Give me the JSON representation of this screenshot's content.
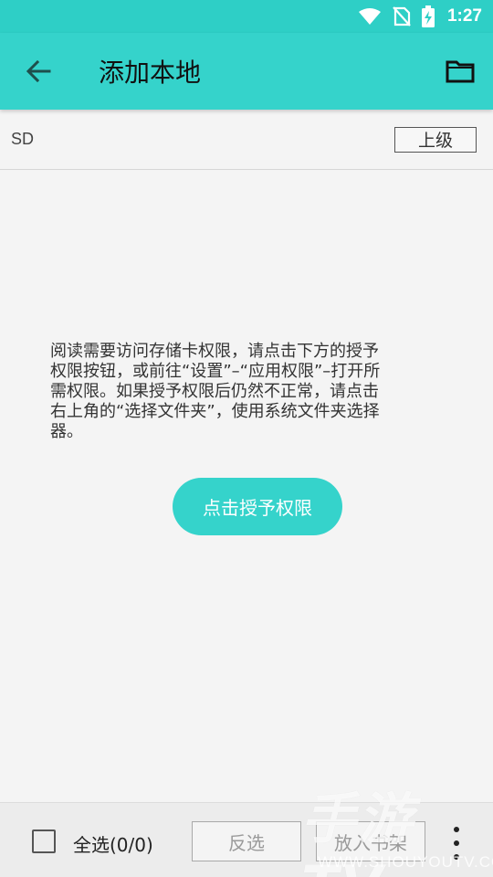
{
  "status_bar": {
    "time": "1:27",
    "icons": [
      "wifi-icon",
      "no-sim-icon",
      "battery-charging-icon"
    ]
  },
  "app_bar": {
    "title": "添加本地",
    "back_icon": "arrow-left-icon",
    "folder_icon": "folder-icon"
  },
  "path_bar": {
    "path": "SD",
    "up_label": "上级"
  },
  "content": {
    "message_lines": [
      "阅读需要访问存储卡权限，请点击下方的授予",
      "权限按钮，或前往“设置”–“应用权限”–打开所",
      "需权限。如果授予权限后仍然不正常，请点击",
      "右上角的“选择文件夹”，使用系统文件夹选择",
      "器。"
    ],
    "grant_label": "点击授予权限"
  },
  "bottom_bar": {
    "select_all_label": "全选(0/0)",
    "select_all_checked": false,
    "invert_label": "反选",
    "add_to_shelf_label": "放入书架",
    "more_icon": "more-vert-icon"
  },
  "watermark": {
    "title": "手游TV",
    "url": "WWW.SHOUYOUTV.COM"
  },
  "colors": {
    "accent": "#35d3cb",
    "status_bar": "#2ecfc6",
    "background": "#f4f4f4"
  }
}
